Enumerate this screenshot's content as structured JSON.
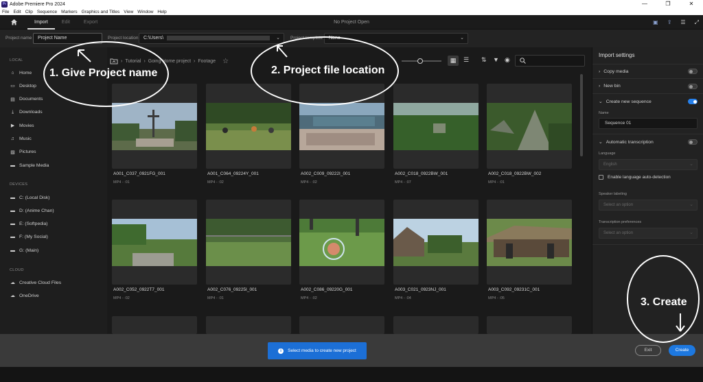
{
  "window": {
    "app_badge": "Pr",
    "title": "Adobe Premiere Pro 2024",
    "controls": [
      "—",
      "❐",
      "✕"
    ]
  },
  "menu": [
    "File",
    "Edit",
    "Clip",
    "Sequence",
    "Markers",
    "Graphics and Titles",
    "View",
    "Window",
    "Help"
  ],
  "workspace": {
    "tabs": [
      "Import",
      "Edit",
      "Export"
    ],
    "active_tab": "Import",
    "center_title": "No Project Open"
  },
  "project": {
    "name_label": "Project name",
    "name_value": "Project Name",
    "location_label": "Project location",
    "location_value": "C:\\Users\\",
    "template_label": "Project template",
    "template_value": "None"
  },
  "sidebar": {
    "local_heading": "LOCAL",
    "local": [
      {
        "label": "Home",
        "icon": "home-icon"
      },
      {
        "label": "Desktop",
        "icon": "monitor-icon"
      },
      {
        "label": "Documents",
        "icon": "document-icon"
      },
      {
        "label": "Downloads",
        "icon": "download-icon"
      },
      {
        "label": "Movies",
        "icon": "film-icon"
      },
      {
        "label": "Music",
        "icon": "music-icon"
      },
      {
        "label": "Pictures",
        "icon": "image-icon"
      },
      {
        "label": "Sample Media",
        "icon": "folder-icon"
      }
    ],
    "devices_heading": "DEVICES",
    "devices": [
      {
        "label": "C: (Local Disk)",
        "icon": "folder-icon"
      },
      {
        "label": "D: (Anime Chan)",
        "icon": "folder-icon"
      },
      {
        "label": "E: (Softpedia)",
        "icon": "folder-icon"
      },
      {
        "label": "F: (My Social)",
        "icon": "folder-icon"
      },
      {
        "label": "G: (Main)",
        "icon": "folder-icon"
      }
    ],
    "cloud_heading": "CLOUD",
    "cloud": [
      {
        "label": "Creative Cloud Files",
        "icon": "cloud-icon"
      },
      {
        "label": "OneDrive",
        "icon": "cloud-icon"
      }
    ]
  },
  "breadcrumb": [
    "Tutorial",
    "Going Home project",
    "Footage"
  ],
  "media": [
    {
      "name": "A001_C037_0921FG_001",
      "meta": "MP4 - :01"
    },
    {
      "name": "A001_C064_09224Y_001",
      "meta": "MP4 - :02"
    },
    {
      "name": "A002_C009_09222I_001",
      "meta": "MP4 - :02"
    },
    {
      "name": "A002_C018_0922BW_001",
      "meta": "MP4 - :07"
    },
    {
      "name": "A002_C018_0922BW_002",
      "meta": "MP4 - :01"
    },
    {
      "name": "A002_C052_0922T7_001",
      "meta": "MP4 - :02"
    },
    {
      "name": "A002_C076_09225I_001",
      "meta": "MP4 - :01"
    },
    {
      "name": "A002_C086_09220G_001",
      "meta": "MP4 - :02"
    },
    {
      "name": "A003_C021_0923NJ_001",
      "meta": "MP4 - :04"
    },
    {
      "name": "A003_C092_09231C_001",
      "meta": "MP4 - :05"
    }
  ],
  "import_settings": {
    "title": "Import settings",
    "copy_media": "Copy media",
    "new_bin": "New bin",
    "create_sequence": "Create new sequence",
    "name_label": "Name",
    "sequence_name": "Sequence 01",
    "auto_transcription": "Automatic transcription",
    "language_label": "Language",
    "language_value": "English",
    "auto_detect": "Enable language auto-detection",
    "speaker_label": "Speaker labeling",
    "speaker_placeholder": "Select an option",
    "transcription_pref_label": "Transcription preferences",
    "transcription_pref_placeholder": "Select an option"
  },
  "bottom": {
    "toast": "Select media to create new project",
    "exit": "Exit",
    "create": "Create"
  },
  "annotations": {
    "step1": "1. Give Project name",
    "step2": "2. Project file location",
    "step3": "3. Create"
  },
  "colors": {
    "accent": "#1d78e0",
    "background": "#1d1d1d",
    "panel": "#222222"
  }
}
